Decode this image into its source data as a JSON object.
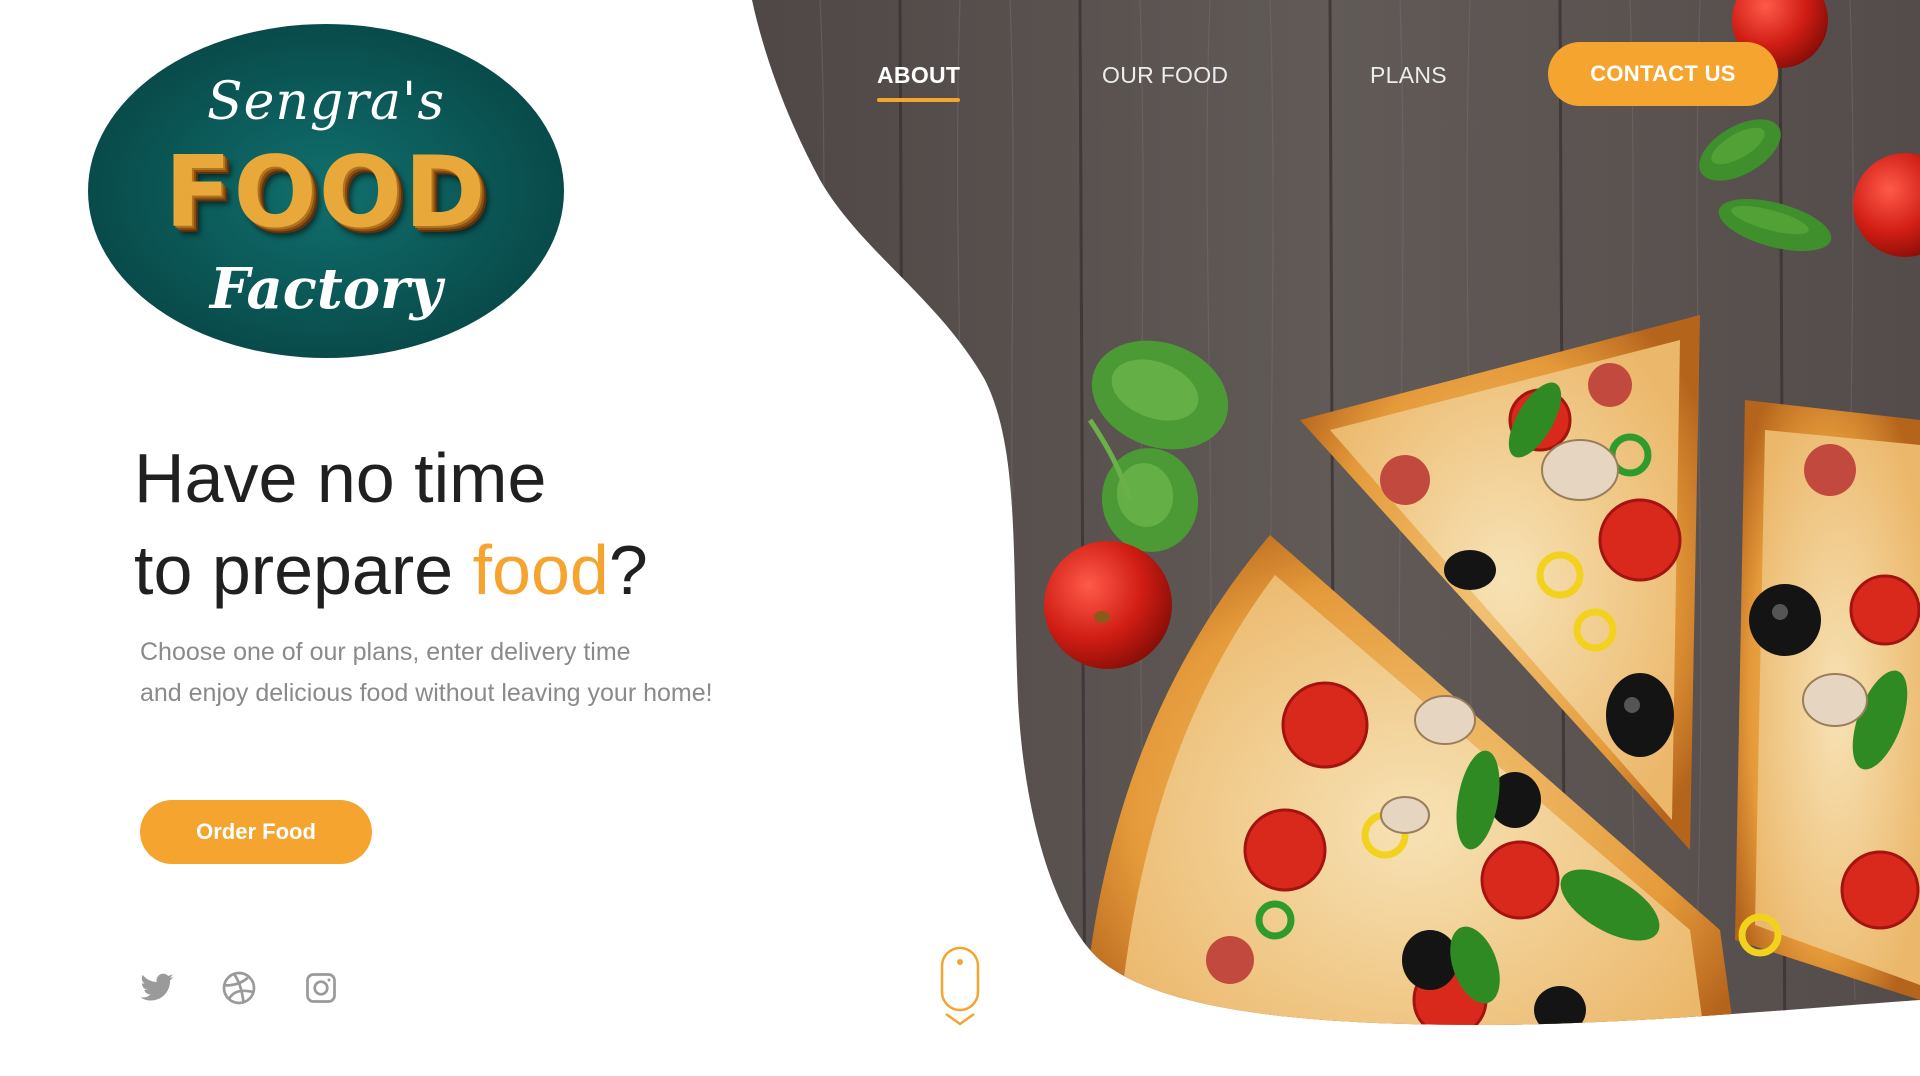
{
  "brand": {
    "script_top": "Sengra's",
    "main_word": "FOOD",
    "script_bottom": "Factory",
    "oval_color": "#0a5352"
  },
  "nav": {
    "items": [
      {
        "label": "ABOUT",
        "active": true
      },
      {
        "label": "OUR FOOD",
        "active": false
      },
      {
        "label": "PLANS",
        "active": false
      }
    ],
    "cta_label": "CONTACT US"
  },
  "hero": {
    "headline_line1": "Have no time",
    "headline_line2_prefix": "to prepare ",
    "headline_accent": "food",
    "headline_suffix": "?",
    "subtext_line1": "Choose one of our plans, enter delivery time",
    "subtext_line2": "and enjoy delicious food without leaving your home!",
    "order_button": "Order Food"
  },
  "social": {
    "icons": [
      "twitter-icon",
      "dribbble-icon",
      "instagram-icon"
    ]
  },
  "scroll_indicator": {
    "icon": "mouse-scroll-icon"
  },
  "colors": {
    "accent": "#f5a52f",
    "headline": "#202020",
    "subtext": "#8a8a8a",
    "social_icon": "#9a9a9a",
    "wood": "#5b5350"
  }
}
